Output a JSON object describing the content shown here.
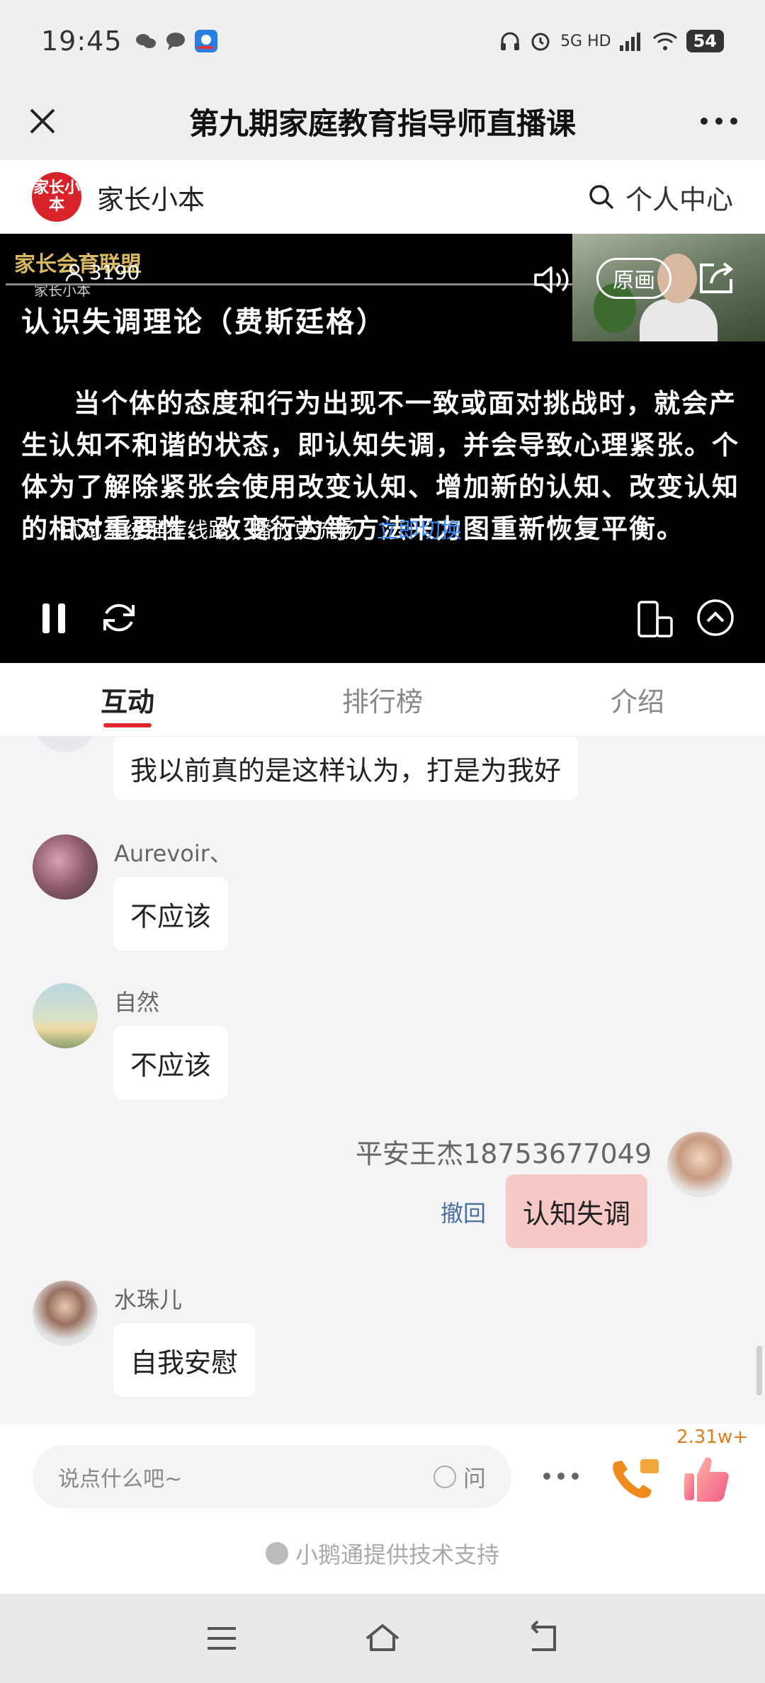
{
  "status_bar": {
    "time": "19:45",
    "network": "5G HD",
    "battery": "54"
  },
  "title_bar": {
    "title": "第九期家庭教育指导师直播课",
    "close_icon": "close-icon",
    "more_icon": "more-icon"
  },
  "shop_bar": {
    "logo_text": "家长小本",
    "name": "家长小本",
    "personal_center": "个人中心"
  },
  "video": {
    "brand": "家长会育联盟",
    "brand_sub": "家长小本",
    "viewer_count": "3190",
    "slide_title": "认识失调理论（费斯廷格）",
    "slide_body": "当个体的态度和行为出现不一致或面对挑战时，就会产生认知不和谐的状态，即认知失调，并会导致心理紧张。个体为了解除紧张会使用改变认知、增加新的认知、改变认知的相对重要性、改变行为等方法来力图重新恢复平衡。",
    "tip_text": "试试系统推荐线路，播放更流畅",
    "tip_link": "立即切换",
    "quality_label": "原画"
  },
  "tabs": [
    {
      "label": "互动",
      "active": true
    },
    {
      "label": "排行榜",
      "active": false
    },
    {
      "label": "介绍",
      "active": false
    }
  ],
  "chat": {
    "messages": [
      {
        "user": "",
        "text": "我以前真的是这样认为，打是为我好",
        "mine": false
      },
      {
        "user": "Aurevoir、",
        "text": "不应该",
        "mine": false
      },
      {
        "user": "自然",
        "text": "不应该",
        "mine": false
      },
      {
        "user": "平安王杰18753677049",
        "text": "认知失调",
        "mine": true,
        "recall": "撤回"
      },
      {
        "user": "水珠儿",
        "text": "自我安慰",
        "mine": false
      }
    ]
  },
  "input_bar": {
    "placeholder": "说点什么吧~",
    "ask_label": "问",
    "like_count": "2.31w+",
    "powered_by": "小鹅通提供技术支持"
  },
  "colors": {
    "accent": "#e0292e",
    "link": "#3b8cff",
    "my_bubble": "#f6c9c7"
  }
}
